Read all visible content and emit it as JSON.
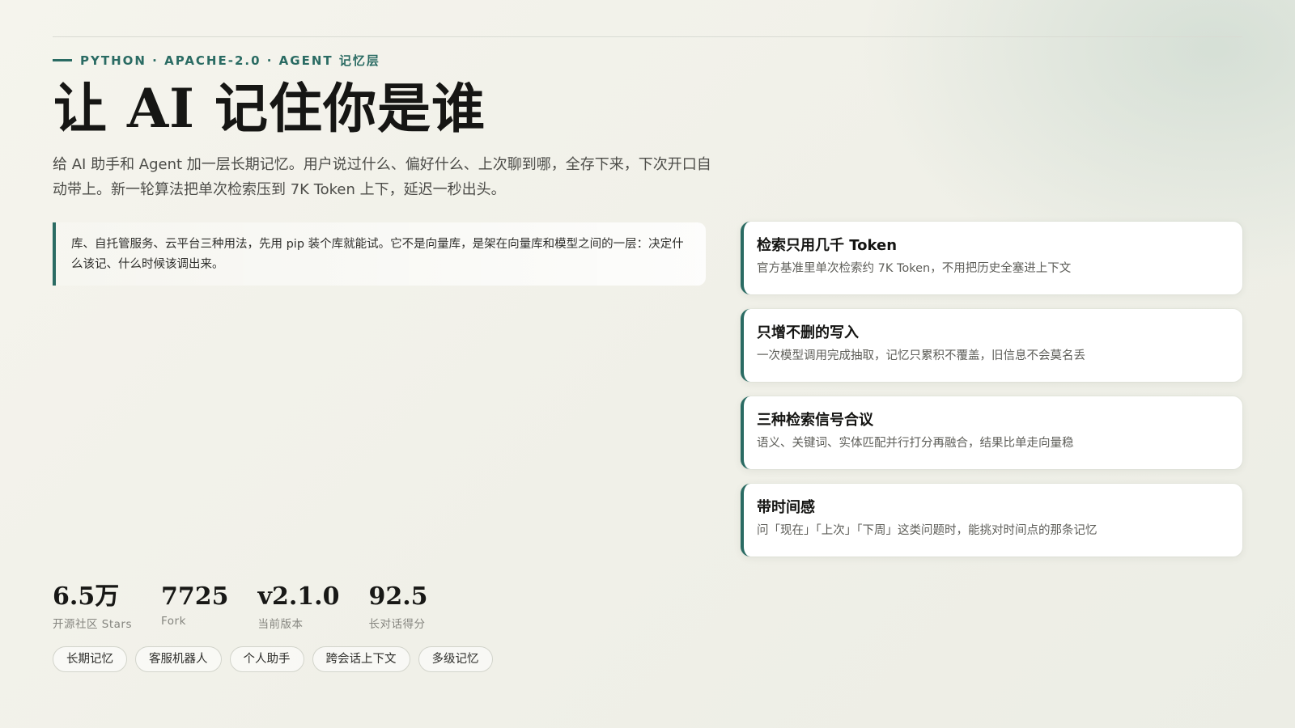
{
  "header": {
    "eyebrow": "PYTHON · APACHE-2.0 · AGENT 记忆层",
    "title": "让 AI 记住你是谁",
    "lead": "给 AI 助手和 Agent 加一层长期记忆。用户说过什么、偏好什么、上次聊到哪，全存下来，下次开口自动带上。新一轮算法把单次检索压到 7K Token 上下，延迟一秒出头。"
  },
  "quote": {
    "text": "库、自托管服务、云平台三种用法，先用 pip 装个库就能试。它不是向量库，是架在向量库和模型之间的一层：决定什么该记、什么时候该调出来。"
  },
  "features": [
    {
      "title": "检索只用几千 Token",
      "desc": "官方基准里单次检索约 7K Token，不用把历史全塞进上下文"
    },
    {
      "title": "只增不删的写入",
      "desc": "一次模型调用完成抽取，记忆只累积不覆盖，旧信息不会莫名丢"
    },
    {
      "title": "三种检索信号合议",
      "desc": "语义、关键词、实体匹配并行打分再融合，结果比单走向量稳"
    },
    {
      "title": "带时间感",
      "desc": "问「现在」「上次」「下周」这类问题时，能挑对时间点的那条记忆"
    }
  ],
  "stats": [
    {
      "value": "6.5万",
      "label": "开源社区 Stars"
    },
    {
      "value": "7725",
      "label": "Fork"
    },
    {
      "value": "v2.1.0",
      "label": "当前版本"
    },
    {
      "value": "92.5",
      "label": "长对话得分"
    }
  ],
  "tags": [
    "长期记忆",
    "客服机器人",
    "个人助手",
    "跨会话上下文",
    "多级记忆"
  ],
  "colors": {
    "accent": "#2a6b63",
    "background": "#f3f2eb",
    "card": "#ffffff",
    "text": "#161614"
  }
}
